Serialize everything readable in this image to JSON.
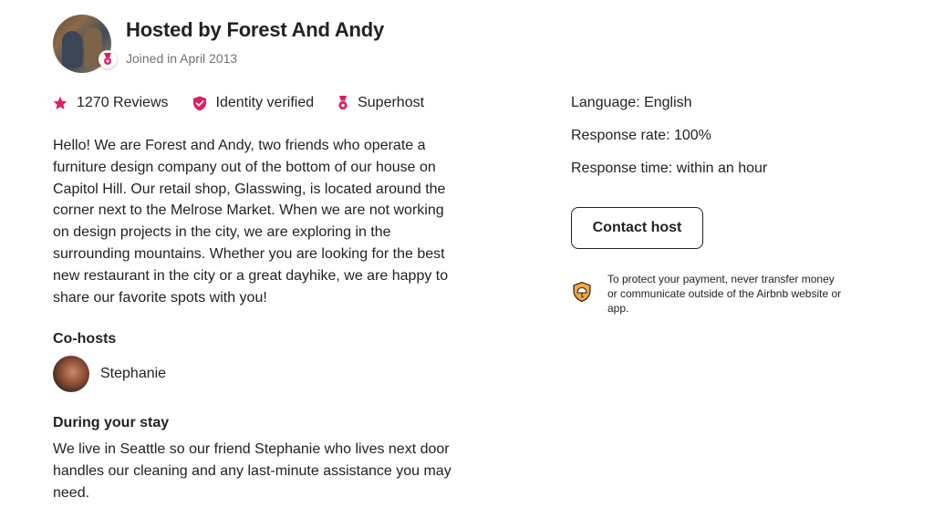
{
  "host": {
    "title": "Hosted by Forest And Andy",
    "joined": "Joined in April 2013"
  },
  "badges": {
    "reviews": "1270 Reviews",
    "identity": "Identity verified",
    "superhost": "Superhost"
  },
  "about": "Hello! We are Forest and Andy, two friends who operate a furniture design company out of the bottom of our house on Capitol Hill. Our retail shop, Glasswing, is located around the corner next to the Melrose Market. When we are not working on design projects in the city, we are exploring in the surrounding mountains. Whether you are looking for the best new restaurant in the city or a great dayhike, we are happy to share our favorite spots with you!",
  "cohosts": {
    "title": "Co-hosts",
    "items": [
      {
        "name": "Stephanie"
      }
    ]
  },
  "stay": {
    "title": "During your stay",
    "text": "We live in Seattle so our friend Stephanie who lives next door handles our cleaning and any last-minute assistance you may need."
  },
  "info": {
    "language": "Language: English",
    "response_rate": "Response rate: 100%",
    "response_time": "Response time: within an hour"
  },
  "contact_label": "Contact host",
  "protection_text": "To protect your payment, never transfer money or communicate outside of the Airbnb website or app.",
  "colors": {
    "accent": "#E31C5F",
    "text": "#222222",
    "muted": "#717171",
    "shield": "#F2A53A"
  },
  "icons": {
    "reviews": "star-icon",
    "identity": "shield-check-icon",
    "superhost": "medal-icon",
    "protection": "umbrella-shield-icon"
  }
}
